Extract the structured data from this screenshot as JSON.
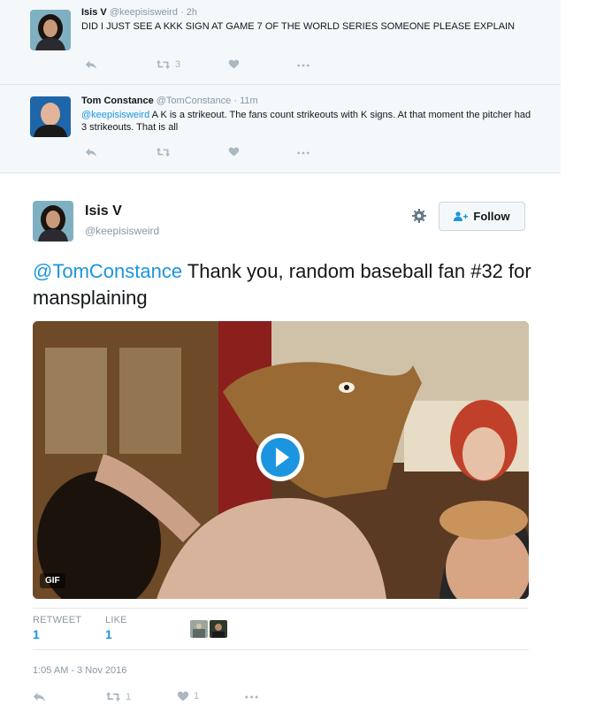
{
  "replies": [
    {
      "name": "Isis V",
      "handle": "@keepisisweird",
      "time": "· 2h",
      "text": "DID I JUST SEE A KKK SIGN AT GAME 7 OF THE WORLD SERIES SOMEONE PLEASE EXPLAIN",
      "retweets": "3",
      "likes": "",
      "avatar_icon": "avatar-woman"
    },
    {
      "name": "Tom Constance",
      "handle": "@TomConstance",
      "time": "· 11m",
      "mention": "@keepisisweird",
      "text": " A K is a strikeout. The fans count strikeouts with K signs. At that moment the pitcher had 3 strikeouts. That is all",
      "retweets": "",
      "likes": "",
      "avatar_icon": "avatar-man"
    }
  ],
  "main": {
    "name": "Isis V",
    "handle": "@keepisisweird",
    "follow_label": "Follow",
    "mention": "@TomConstance",
    "text": " Thank you, random baseball fan #32 for mansplaining",
    "gif_label": "GIF",
    "stats": {
      "retweet_label": "RETWEET",
      "retweet_count": "1",
      "like_label": "LIKE",
      "like_count": "1"
    },
    "timestamp": "1:05 AM - 3 Nov 2016",
    "actions": {
      "retweets": "1",
      "likes": "1"
    }
  },
  "colors": {
    "link": "#1b95e0",
    "icon": "#aab8c2",
    "muted": "#8899a6",
    "reply_bg": "#f5f8fa"
  },
  "icons": [
    "reply-icon",
    "retweet-icon",
    "like-icon",
    "more-icon",
    "gear-icon",
    "follow-person-icon",
    "play-icon"
  ]
}
